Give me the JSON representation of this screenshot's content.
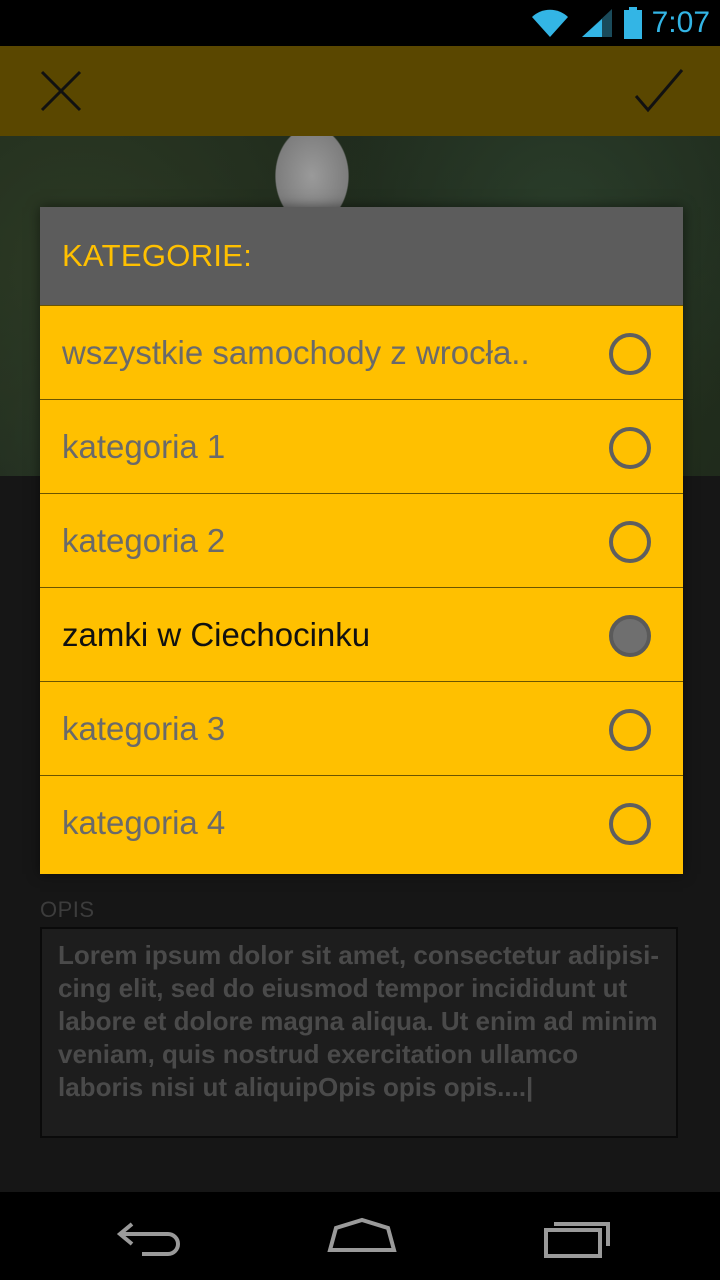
{
  "status_bar": {
    "time": "7:07"
  },
  "dialog": {
    "title": "KATEGORIE:",
    "options": [
      {
        "label": "wszystkie samochody z wrocła..",
        "selected": false
      },
      {
        "label": "kategoria 1",
        "selected": false
      },
      {
        "label": "kategoria 2",
        "selected": false
      },
      {
        "label": "zamki w Ciechocinku",
        "selected": true
      },
      {
        "label": "kategoria 3",
        "selected": false
      },
      {
        "label": "kategoria 4",
        "selected": false
      }
    ]
  },
  "form": {
    "description_label": "OPIS",
    "description_value": "Lorem ipsum dolor sit amet, consectetur adipisi­cing elit, sed do eiusmod tempor incididunt ut labore et dolore magna aliqua. Ut enim ad minim veniam, quis nostrud exercitation ullam­co laboris nisi ut aliquipOpis opis opis....|"
  },
  "colors": {
    "accent": "#ffc000",
    "status_time": "#33b5e5",
    "dialog_header": "#5c5c5c",
    "action_bar": "#5a4700"
  },
  "icons": {
    "close": "close-icon",
    "confirm": "checkmark-icon",
    "wifi": "wifi-icon",
    "signal": "signal-icon",
    "battery": "battery-icon",
    "back": "back-icon",
    "home": "home-icon",
    "recents": "recents-icon"
  }
}
